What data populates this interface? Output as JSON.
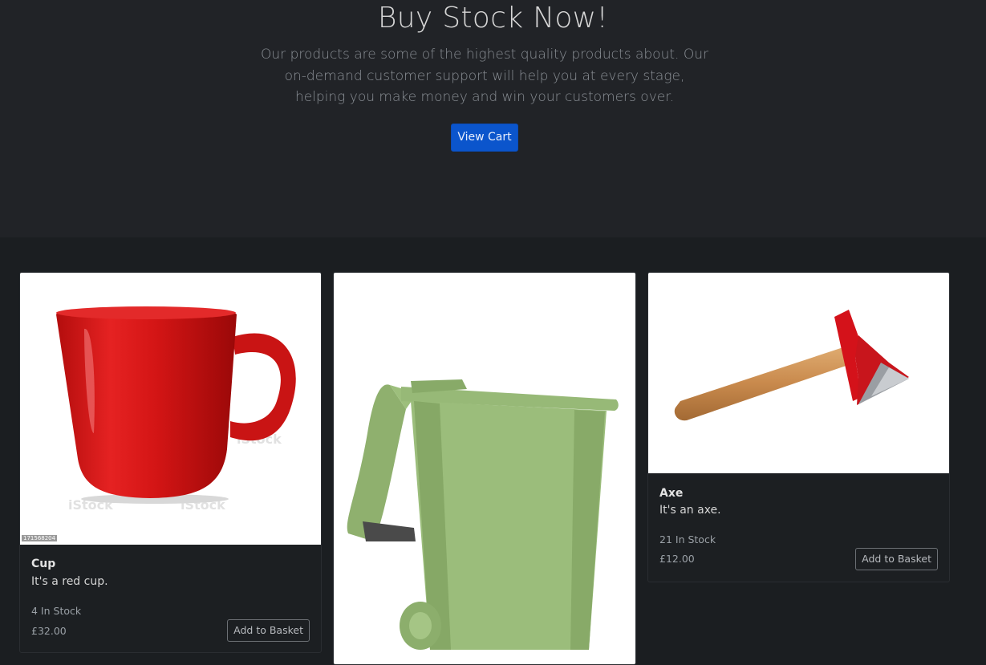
{
  "hero": {
    "title": "Buy Stock Now!",
    "lead": "Our products are some of the highest quality products about. Our on-demand customer support will help you at every stage, helping you make money and win your customers over.",
    "view_cart_label": "View Cart"
  },
  "products": [
    {
      "name": "Cup",
      "description": "It's a red cup.",
      "stock": "4 In Stock",
      "price": "£32.00",
      "button_label": "Add to Basket",
      "image": "red-mug",
      "watermark": "iStock",
      "image_code": "171568204"
    },
    {
      "name": "",
      "description": "",
      "stock": "",
      "price": "",
      "button_label": "",
      "image": "green-wheelie-bin"
    },
    {
      "name": "Axe",
      "description": "It's an axe.",
      "stock": "21 In Stock",
      "price": "£12.00",
      "button_label": "Add to Basket",
      "image": "red-axe"
    }
  ],
  "colors": {
    "primary_button": "#0b55cc",
    "hero_bg": "#212327",
    "page_bg": "#1b1e21"
  }
}
